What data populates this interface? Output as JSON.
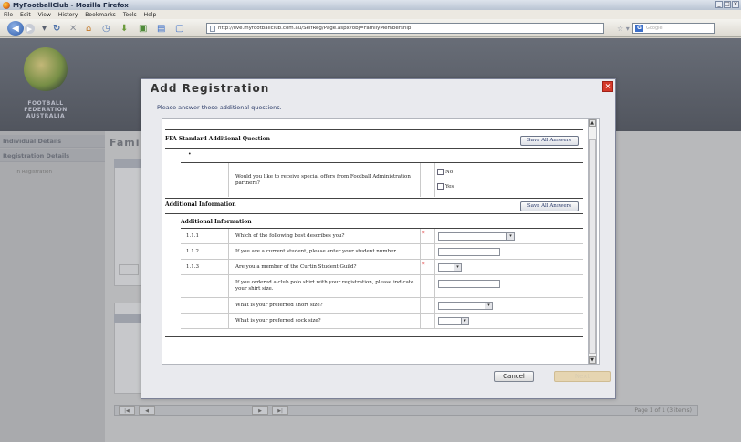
{
  "browser": {
    "title": "MyFootballClub - Mozilla Firefox",
    "menu": [
      "File",
      "Edit",
      "View",
      "History",
      "Bookmarks",
      "Tools",
      "Help"
    ],
    "url": "http://live.myfootballclub.com.au/SelfReg/Page.aspx?obj=FamilyMembership",
    "search_placeholder": "Google",
    "win_buttons": [
      "_",
      "□",
      "×"
    ]
  },
  "page": {
    "org_name": [
      "FOOTBALL",
      "FEDERATION",
      "AUSTRALIA"
    ],
    "sidebar": [
      {
        "label": "Individual Details"
      },
      {
        "label": "Registration Details"
      }
    ],
    "sidebar_sub": "In Registration",
    "family_heading": "Famil",
    "pager_text": "Page 1 of 1 (3 items)"
  },
  "modal": {
    "title": "Add Registration",
    "subtitle": "Please answer these additional questions.",
    "close_label": "×",
    "ffa_section": {
      "heading": "FFA Standard Additional Question",
      "save_all_label": "Save All Answers",
      "bullet": "•",
      "question": "Would you like to receive special offers from Football Administration partners?",
      "options": [
        "No",
        "Yes"
      ]
    },
    "additional_section": {
      "heading": "Additional Information",
      "save_all_label": "Save All Answers",
      "subheading": "Additional Information",
      "rows": [
        {
          "num": "1.1.1",
          "question": "Which of the following best describes you?",
          "required": true,
          "field": "select"
        },
        {
          "num": "1.1.2",
          "question": "If you are a current student, please enter your student number.",
          "required": false,
          "field": "text"
        },
        {
          "num": "1.1.3",
          "question": "Are you a member of the Curtin Student Guild?",
          "required": true,
          "field": "select-small"
        },
        {
          "num": "",
          "question": "If you ordered a club polo shirt with your registration, please indicate your shirt size.",
          "required": false,
          "field": "text"
        },
        {
          "num": "",
          "question": "What is your preferred short size?",
          "required": false,
          "field": "select"
        },
        {
          "num": "",
          "question": "What is your preferred sock size?",
          "required": false,
          "field": "select-small"
        }
      ],
      "required_marker": "*"
    },
    "cancel_label": "Cancel",
    "next_label": "Next"
  }
}
